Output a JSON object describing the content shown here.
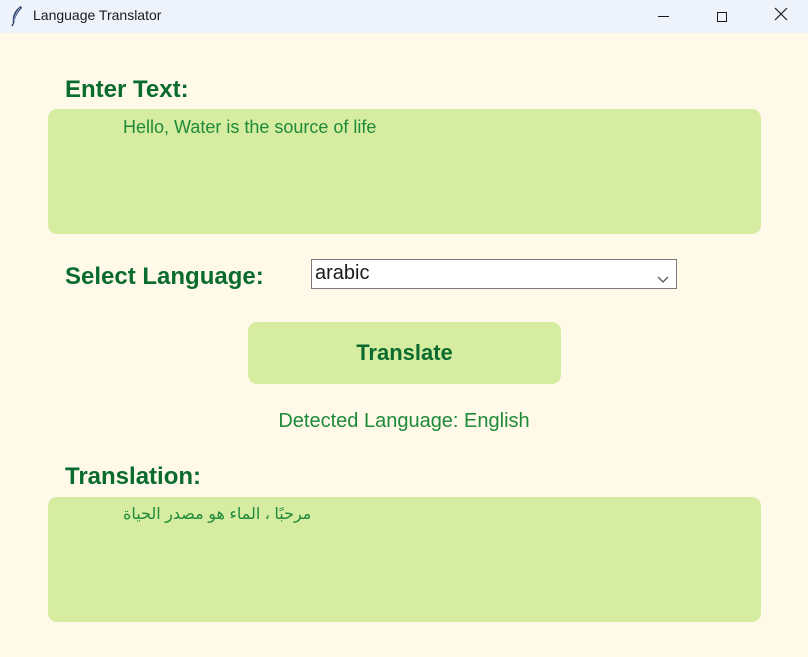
{
  "window": {
    "title": "Language Translator",
    "app_icon": "feather-icon",
    "controls": [
      "minimize-icon",
      "maximize-icon",
      "close-icon"
    ]
  },
  "input": {
    "label": "Enter Text:",
    "value": "Hello, Water is the source of life"
  },
  "language": {
    "label": "Select Language:",
    "selected": "arabic"
  },
  "actions": {
    "translate_label": "Translate"
  },
  "detected": {
    "text": "Detected Language: English"
  },
  "output": {
    "label": "Translation:",
    "value": "مرحبًا ، الماء هو مصدر الحياة"
  },
  "colors": {
    "background": "#fef9e8",
    "titlebar": "#eef2fa",
    "panel": "#d6eda1",
    "heading": "#0a6b2f",
    "text": "#1f8a3a"
  }
}
